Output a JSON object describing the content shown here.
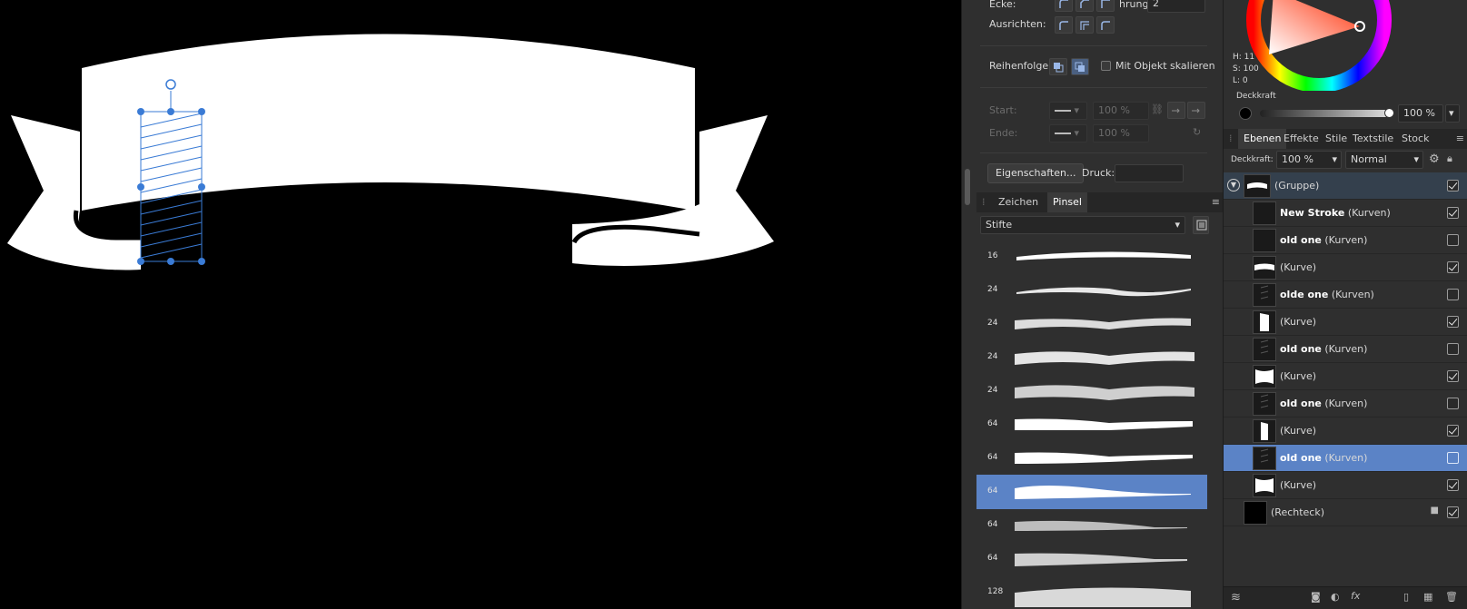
{
  "context_toolbar": {
    "ecke_label": "Ecke:",
    "fuehrung_label": "hrung:",
    "fuehrung_value": "2",
    "ausrichten_label": "Ausrichten:",
    "reihenfolge_label": "Reihenfolge:",
    "scale_with_object_label": "Mit Objekt skalieren",
    "start_label": "Start:",
    "start_percent": "100 %",
    "ende_label": "Ende:",
    "ende_percent": "100 %",
    "properties_button": "Eigenschaften...",
    "pressure_label": "Druck:"
  },
  "brush_panel": {
    "tabs": [
      "Zeichen",
      "Pinsel"
    ],
    "active_tab": "Pinsel",
    "category": "Stifte",
    "brushes": [
      {
        "size": "16"
      },
      {
        "size": "24"
      },
      {
        "size": "24"
      },
      {
        "size": "24"
      },
      {
        "size": "24"
      },
      {
        "size": "64"
      },
      {
        "size": "64"
      },
      {
        "size": "64",
        "selected": true
      },
      {
        "size": "64"
      },
      {
        "size": "64"
      },
      {
        "size": "128"
      }
    ]
  },
  "color_panel": {
    "h_label": "H: 11",
    "s_label": "S: 100",
    "l_label": "L: 0",
    "opacity_label": "Deckkraft",
    "opacity_value": "100 %"
  },
  "layers_panel": {
    "tabs": [
      "Ebenen",
      "Effekte",
      "Stile",
      "Textstile",
      "Stock"
    ],
    "active_tab": "Ebenen",
    "opacity_label": "Deckkraft:",
    "opacity_value": "100 %",
    "blend_mode": "Normal",
    "layers": [
      {
        "name": "",
        "type": "(Gruppe)",
        "visible": true
      },
      {
        "name": "New Stroke",
        "type": "(Kurven)",
        "visible": true
      },
      {
        "name": "old one",
        "type": "(Kurven)",
        "visible": false
      },
      {
        "name": "",
        "type": "(Kurve)",
        "visible": true
      },
      {
        "name": "olde one",
        "type": "(Kurven)",
        "visible": false
      },
      {
        "name": "",
        "type": "(Kurve)",
        "visible": true
      },
      {
        "name": "old one",
        "type": "(Kurven)",
        "visible": false
      },
      {
        "name": "",
        "type": "(Kurve)",
        "visible": true
      },
      {
        "name": "old one",
        "type": "(Kurven)",
        "visible": false
      },
      {
        "name": "",
        "type": "(Kurve)",
        "visible": true
      },
      {
        "name": "old one",
        "type": "(Kurven)",
        "visible": false,
        "selected": true
      },
      {
        "name": "",
        "type": "(Kurve)",
        "visible": true
      },
      {
        "name": "",
        "type": "(Rechteck)",
        "visible": true,
        "locked": true
      }
    ]
  },
  "colors": {
    "accent": "#5b83c6",
    "canvas": "#000000",
    "panel": "#2f2f2f",
    "selection": "#3a7bd5"
  }
}
